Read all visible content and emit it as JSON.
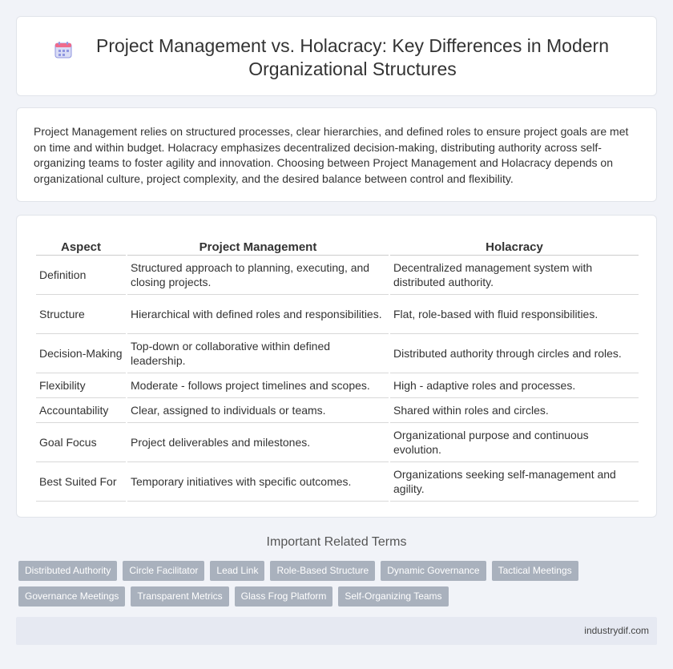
{
  "header": {
    "icon": "calendar-icon",
    "title": "Project Management vs. Holacracy: Key Differences in Modern Organizational Structures"
  },
  "intro": {
    "text": "Project Management relies on structured processes, clear hierarchies, and defined roles to ensure project goals are met on time and within budget. Holacracy emphasizes decentralized decision-making, distributing authority across self-organizing teams to foster agility and innovation. Choosing between Project Management and Holacracy depends on organizational culture, project complexity, and the desired balance between control and flexibility."
  },
  "table": {
    "headers": [
      "Aspect",
      "Project Management",
      "Holacracy"
    ],
    "rows": [
      [
        "Definition",
        "Structured approach to planning, executing, and closing projects.",
        "Decentralized management system with distributed authority."
      ],
      [
        "Structure",
        "Hierarchical with defined roles and responsibilities.",
        "Flat, role-based with fluid responsibilities."
      ],
      [
        "Decision-Making",
        "Top-down or collaborative within defined leadership.",
        "Distributed authority through circles and roles."
      ],
      [
        "Flexibility",
        "Moderate - follows project timelines and scopes.",
        "High - adaptive roles and processes."
      ],
      [
        "Accountability",
        "Clear, assigned to individuals or teams.",
        "Shared within roles and circles."
      ],
      [
        "Goal Focus",
        "Project deliverables and milestones.",
        "Organizational purpose and continuous evolution."
      ],
      [
        "Best Suited For",
        "Temporary initiatives with specific outcomes.",
        "Organizations seeking self-management and agility."
      ]
    ]
  },
  "related": {
    "title": "Important Related Terms",
    "tags": [
      "Distributed Authority",
      "Circle Facilitator",
      "Lead Link",
      "Role-Based Structure",
      "Dynamic Governance",
      "Tactical Meetings",
      "Governance Meetings",
      "Transparent Metrics",
      "Glass Frog Platform",
      "Self-Organizing Teams"
    ]
  },
  "footer": {
    "site": "industrydif.com"
  },
  "colors": {
    "background": "#f1f3f8",
    "tag_bg": "#a9b1bd",
    "footer_bg": "#e6e9f2"
  }
}
